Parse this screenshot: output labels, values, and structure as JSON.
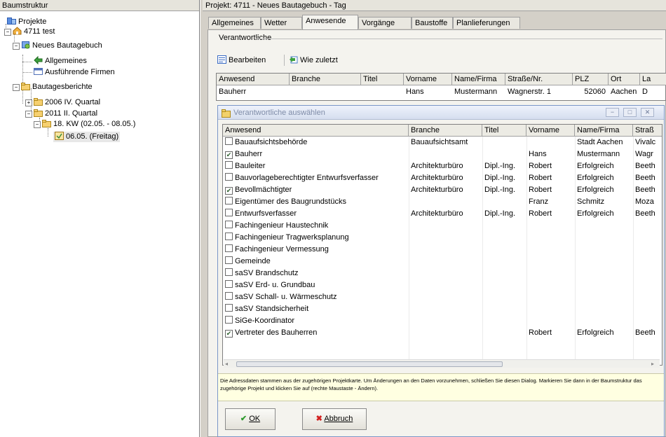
{
  "left_panel": {
    "title": "Baumstruktur",
    "tree": [
      {
        "label": "Projekte",
        "icon": "projects-icon"
      },
      {
        "label": "4711 test",
        "icon": "house-icon"
      },
      {
        "label": "Neues Bautagebuch",
        "icon": "diary-icon"
      },
      {
        "label": "Allgemeines",
        "icon": "green-arrow-icon"
      },
      {
        "label": "Ausführende Firmen",
        "icon": "table-icon"
      },
      {
        "label": "Bautagesberichte",
        "icon": "folder-icon"
      },
      {
        "label": "2006 IV. Quartal",
        "icon": "folder-icon"
      },
      {
        "label": "2011 II. Quartal",
        "icon": "folder-icon"
      },
      {
        "label": "18. KW (02.05. - 08.05.)",
        "icon": "folder-icon"
      },
      {
        "label": "06.05. (Freitag)",
        "icon": "day-icon"
      }
    ]
  },
  "right_panel": {
    "title": "Projekt: 4711 - Neues Bautagebuch - Tag",
    "tabs": [
      "Allgemeines",
      "Wetter",
      "Anwesende",
      "Vorgänge",
      "Baustoffe",
      "Planlieferungen"
    ],
    "section_label": "Verantwortliche",
    "toolbar": {
      "edit": "Bearbeiten",
      "like_last": "Wie zuletzt"
    },
    "grid": {
      "columns": [
        "Anwesend",
        "Branche",
        "Titel",
        "Vorname",
        "Name/Firma",
        "Straße/Nr.",
        "PLZ",
        "Ort",
        "La"
      ],
      "row": [
        "Bauherr",
        "",
        "",
        "Hans",
        "Mustermann",
        "Wagnerstr. 1",
        "52060",
        "Aachen",
        "D"
      ]
    }
  },
  "dialog": {
    "title": "Verantwortliche auswählen",
    "window_buttons": [
      "−",
      "□",
      "✕"
    ],
    "columns": [
      "Anwesend",
      "Branche",
      "Titel",
      "Vorname",
      "Name/Firma",
      "Straß"
    ],
    "rows": [
      {
        "checked": false,
        "anwesend": "Bauaufsichtsbehörde",
        "branche": "Bauaufsichtsamt",
        "titel": "",
        "vorname": "",
        "name": "Stadt Aachen",
        "strasse": "Vivalc"
      },
      {
        "checked": true,
        "anwesend": "Bauherr",
        "branche": "",
        "titel": "",
        "vorname": "Hans",
        "name": "Mustermann",
        "strasse": "Wagr"
      },
      {
        "checked": false,
        "anwesend": "Bauleiter",
        "branche": "Architekturbüro",
        "titel": "Dipl.-Ing.",
        "vorname": "Robert",
        "name": "Erfolgreich",
        "strasse": "Beeth"
      },
      {
        "checked": false,
        "anwesend": "Bauvorlageberechtigter Entwurfsverfasser",
        "branche": "Architekturbüro",
        "titel": "Dipl.-Ing.",
        "vorname": "Robert",
        "name": "Erfolgreich",
        "strasse": "Beeth"
      },
      {
        "checked": true,
        "anwesend": "Bevollmächtigter",
        "branche": "Architekturbüro",
        "titel": "Dipl.-Ing.",
        "vorname": "Robert",
        "name": "Erfolgreich",
        "strasse": "Beeth"
      },
      {
        "checked": false,
        "anwesend": "Eigentümer des Baugrundstücks",
        "branche": "",
        "titel": "",
        "vorname": "Franz",
        "name": "Schmitz",
        "strasse": "Moza"
      },
      {
        "checked": false,
        "anwesend": "Entwurfsverfasser",
        "branche": "Architekturbüro",
        "titel": "Dipl.-Ing.",
        "vorname": "Robert",
        "name": "Erfolgreich",
        "strasse": "Beeth"
      },
      {
        "checked": false,
        "anwesend": "Fachingenieur Haustechnik",
        "branche": "",
        "titel": "",
        "vorname": "",
        "name": "",
        "strasse": ""
      },
      {
        "checked": false,
        "anwesend": "Fachingenieur Tragwerksplanung",
        "branche": "",
        "titel": "",
        "vorname": "",
        "name": "",
        "strasse": ""
      },
      {
        "checked": false,
        "anwesend": "Fachingenieur Vermessung",
        "branche": "",
        "titel": "",
        "vorname": "",
        "name": "",
        "strasse": ""
      },
      {
        "checked": false,
        "anwesend": "Gemeinde",
        "branche": "",
        "titel": "",
        "vorname": "",
        "name": "",
        "strasse": ""
      },
      {
        "checked": false,
        "anwesend": "saSV Brandschutz",
        "branche": "",
        "titel": "",
        "vorname": "",
        "name": "",
        "strasse": ""
      },
      {
        "checked": false,
        "anwesend": "saSV Erd- u. Grundbau",
        "branche": "",
        "titel": "",
        "vorname": "",
        "name": "",
        "strasse": ""
      },
      {
        "checked": false,
        "anwesend": "saSV Schall- u. Wärmeschutz",
        "branche": "",
        "titel": "",
        "vorname": "",
        "name": "",
        "strasse": ""
      },
      {
        "checked": false,
        "anwesend": "saSV Standsicherheit",
        "branche": "",
        "titel": "",
        "vorname": "",
        "name": "",
        "strasse": ""
      },
      {
        "checked": false,
        "anwesend": "SiGe-Koordinator",
        "branche": "",
        "titel": "",
        "vorname": "",
        "name": "",
        "strasse": ""
      },
      {
        "checked": true,
        "anwesend": "Vertreter des Bauherren",
        "branche": "",
        "titel": "",
        "vorname": "Robert",
        "name": "Erfolgreich",
        "strasse": "Beeth"
      }
    ],
    "info_text": "Die Adressdaten stammen aus der zugehörigen Projektkarte. Um Änderungen an den Daten vorzunehmen, schließen Sie diesen Dialog. Markieren Sie dann in der Baumstruktur das zugehörige Projekt und klicken Sie auf (rechte Maustaste - Ändern).",
    "ok_label": "OK",
    "cancel_label": "Abbruch",
    "colors": {
      "check": "#2b5d2b",
      "ok_check": "#2e9a2e",
      "cancel_x": "#d22020",
      "info_bg": "#ffffe1"
    }
  }
}
